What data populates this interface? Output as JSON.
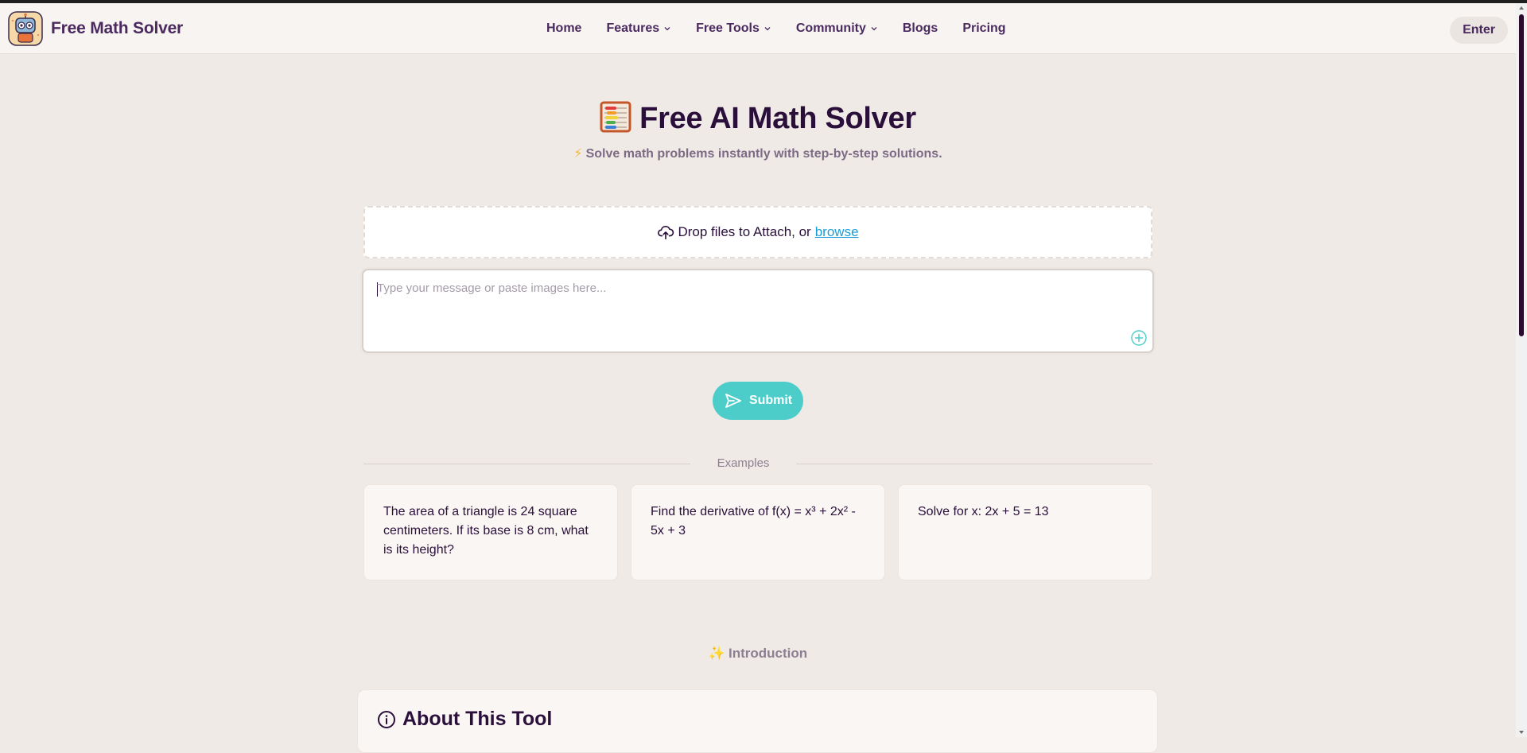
{
  "header": {
    "brand": "Free Math Solver",
    "nav": [
      {
        "label": "Home",
        "dropdown": false
      },
      {
        "label": "Features",
        "dropdown": true
      },
      {
        "label": "Free Tools",
        "dropdown": true
      },
      {
        "label": "Community",
        "dropdown": true
      },
      {
        "label": "Blogs",
        "dropdown": false
      },
      {
        "label": "Pricing",
        "dropdown": false
      }
    ],
    "enter_label": "Enter"
  },
  "hero": {
    "title": "Free AI Math Solver",
    "subtitle": "Solve math problems instantly with step-by-step solutions."
  },
  "upload": {
    "text": "Drop files to Attach, or",
    "browse_label": "browse",
    "icon": "cloud-upload-icon"
  },
  "message": {
    "placeholder": "Type your message or paste images here...",
    "value": ""
  },
  "submit": {
    "label": "Submit",
    "icon": "send-icon"
  },
  "examples": {
    "label": "Examples",
    "items": [
      "The area of a triangle is 24 square centimeters. If its base is 8 cm, what is its height?",
      "Find the derivative of f(x) = x³ + 2x² - 5x + 3",
      "Solve for x: 2x + 5 = 13"
    ]
  },
  "introduction": {
    "label": "Introduction",
    "about_title": "About This Tool"
  },
  "colors": {
    "accent": "#4ccdc9",
    "link": "#1a9dd6",
    "text": "#2a0f3a",
    "background": "#efeae6"
  }
}
